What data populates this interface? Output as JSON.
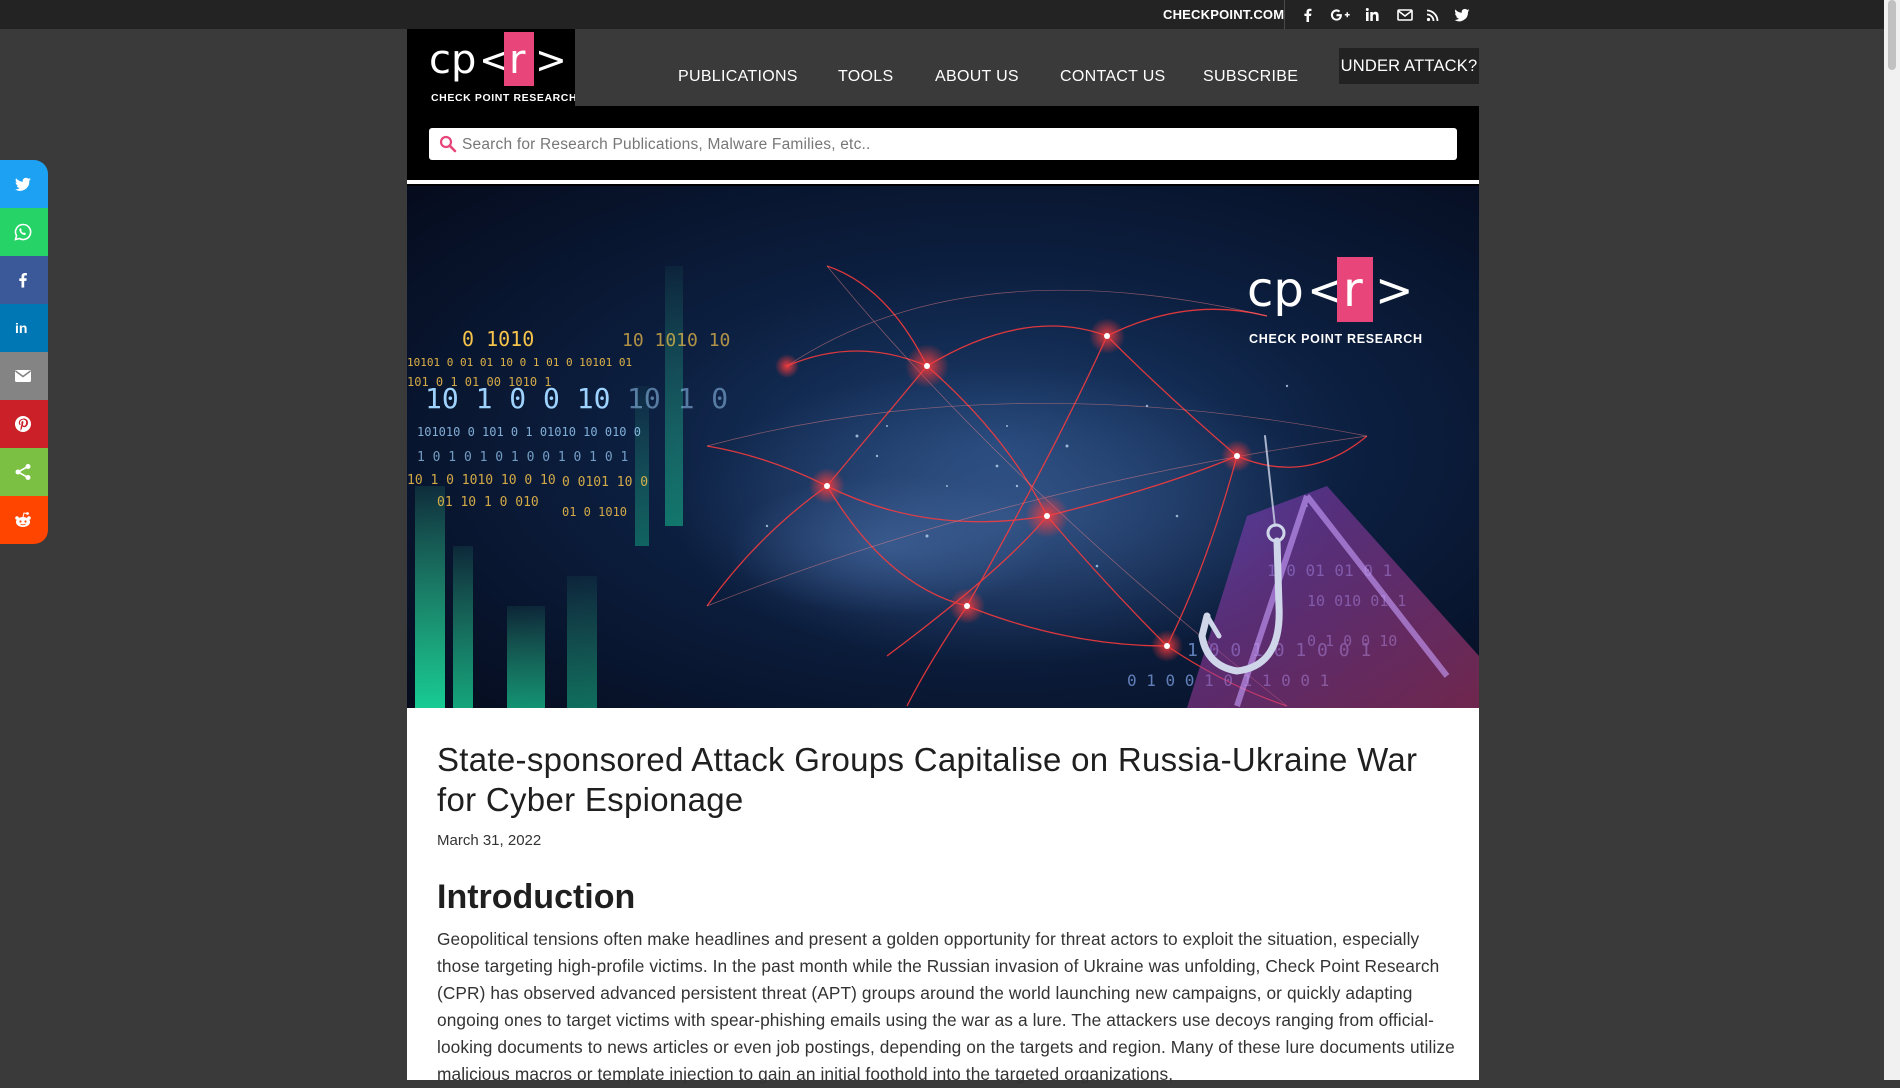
{
  "topbar": {
    "checkpoint_link": "CHECKPOINT.COM",
    "social_icons": [
      "facebook-icon",
      "google-plus-icon",
      "linkedin-icon",
      "mail-icon",
      "rss-icon",
      "twitter-icon"
    ]
  },
  "logo": {
    "mark": "cp<r>",
    "tagline": "CHECK POINT RESEARCH"
  },
  "nav": {
    "items": [
      {
        "label": "PUBLICATIONS"
      },
      {
        "label": "TOOLS"
      },
      {
        "label": "ABOUT US"
      },
      {
        "label": "CONTACT US"
      },
      {
        "label": "SUBSCRIBE"
      }
    ],
    "attack_button": "UNDER ATTACK?"
  },
  "search": {
    "placeholder": "Search for Research Publications, Malware Families, etc.."
  },
  "hero": {
    "logo_mark": "cp<r>",
    "logo_tagline": "CHECK POINT RESEARCH"
  },
  "article": {
    "title": "State-sponsored Attack Groups Capitalise on Russia-Ukraine War for Cyber Espionage",
    "date": "March 31, 2022",
    "section_heading": "Introduction",
    "paragraph": "Geopolitical tensions often make headlines and present a golden opportunity for threat actors to exploit the situation, especially those targeting high-profile victims. In the past month while the Russian invasion of Ukraine was unfolding, Check Point Research (CPR) has observed advanced persistent threat (APT) groups around the world launching new campaigns, or quickly adapting ongoing ones to target victims with spear-phishing emails using the war as a lure. The attackers use decoys ranging from official-looking documents to news articles or even job postings, depending on the targets and region. Many of these lure documents utilize malicious macros or template injection to gain an initial foothold into the targeted organizations,"
  },
  "share_bar": {
    "buttons": [
      {
        "name": "twitter",
        "icon": "twitter-icon",
        "color": "#1da1f2"
      },
      {
        "name": "whatsapp",
        "icon": "whatsapp-icon",
        "color": "#25d366"
      },
      {
        "name": "facebook",
        "icon": "facebook-icon",
        "color": "#3b5998"
      },
      {
        "name": "linkedin",
        "icon": "linkedin-icon",
        "color": "#0077b5"
      },
      {
        "name": "email",
        "icon": "email-icon",
        "color": "#848484"
      },
      {
        "name": "pinterest",
        "icon": "pinterest-icon",
        "color": "#cb2027"
      },
      {
        "name": "share",
        "icon": "share-icon",
        "color": "#7bc043"
      },
      {
        "name": "reddit",
        "icon": "reddit-icon",
        "color": "#ff4500"
      }
    ]
  },
  "colors": {
    "brand_pink": "#e8457a",
    "page_bg": "#3a3a3a",
    "topbar_bg": "#232323"
  }
}
